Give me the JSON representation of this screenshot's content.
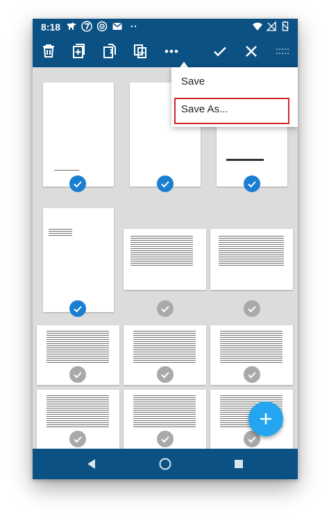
{
  "status_bar": {
    "time": "8:18",
    "left_icons": [
      "dog-icon",
      "seven-badge-icon",
      "target-icon",
      "gmail-icon",
      "more-dots-icon"
    ],
    "right_icons": [
      "wifi-icon",
      "no-signal-icon",
      "battery-icon"
    ]
  },
  "toolbar": {
    "buttons": [
      "delete-icon",
      "add-page-icon",
      "rotate-page-icon",
      "duplicate-page-icon",
      "more-options-icon",
      "confirm-icon",
      "close-icon",
      "drag-handle-icon"
    ]
  },
  "menu": {
    "items": [
      {
        "label": "Save"
      },
      {
        "label": "Save As..."
      }
    ],
    "highlighted": "Save As..."
  },
  "pages": {
    "selected_count": 4,
    "states": [
      "selected",
      "selected",
      "selected",
      "selected",
      "unselected",
      "unselected",
      "unselected",
      "unselected",
      "unselected",
      "unselected",
      "unselected",
      "unselected"
    ]
  },
  "colors": {
    "primary": "#0b5183",
    "check_selected": "#1a7ed1",
    "check_unselected": "#a9a9a9",
    "fab": "#23a6ef",
    "highlight_outline": "#d2232a"
  },
  "fab": {
    "icon": "plus-icon"
  },
  "nav_bar": {
    "buttons": [
      "back-icon",
      "home-icon",
      "recents-icon"
    ]
  }
}
